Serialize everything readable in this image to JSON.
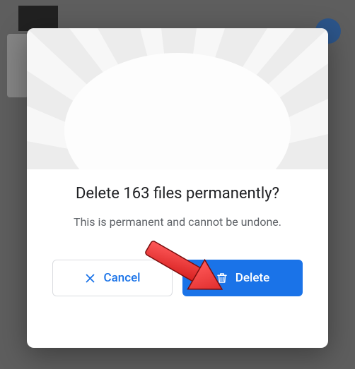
{
  "dialog": {
    "title": "Delete 163 files permanently?",
    "subtitle": "This is permanent and cannot be undone.",
    "cancel_label": "Cancel",
    "delete_label": "Delete"
  },
  "colors": {
    "primary": "#1a73e8",
    "text": "#202124",
    "muted": "#5f6368",
    "border": "#dadce0"
  }
}
